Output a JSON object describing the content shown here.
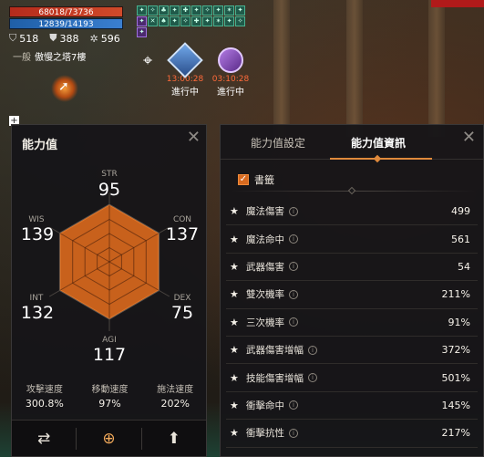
{
  "hud": {
    "hp_text": "68018/73736",
    "mp_text": "12839/14193",
    "stat_a": "518",
    "stat_b": "388",
    "stat_c": "596",
    "location_tag": "一般",
    "location_name": "傲慢之塔7樓",
    "quests": [
      {
        "timer": "13:00:28",
        "state": "進行中"
      },
      {
        "timer": "03:10:28",
        "state": "進行中"
      }
    ]
  },
  "left_panel": {
    "title": "能力值",
    "stats": {
      "str": {
        "label": "STR",
        "value": "95"
      },
      "con": {
        "label": "CON",
        "value": "137"
      },
      "dex": {
        "label": "DEX",
        "value": "75"
      },
      "agi": {
        "label": "AGI",
        "value": "117"
      },
      "int": {
        "label": "INT",
        "value": "132"
      },
      "wis": {
        "label": "WIS",
        "value": "139"
      }
    },
    "speeds": [
      {
        "label": "攻擊速度",
        "value": "300.8%"
      },
      {
        "label": "移動速度",
        "value": "97%"
      },
      {
        "label": "施法速度",
        "value": "202%"
      }
    ]
  },
  "right_panel": {
    "tabs": [
      "能力值設定",
      "能力值資訊"
    ],
    "active_tab": "能力值資訊",
    "bookmark_label": "書籤",
    "rows": [
      {
        "name": "魔法傷害",
        "value": "499"
      },
      {
        "name": "魔法命中",
        "value": "561"
      },
      {
        "name": "武器傷害",
        "value": "54"
      },
      {
        "name": "雙次機率",
        "value": "211%"
      },
      {
        "name": "三次機率",
        "value": "91%"
      },
      {
        "name": "武器傷害增幅",
        "value": "372%"
      },
      {
        "name": "技能傷害增幅",
        "value": "501%"
      },
      {
        "name": "衝擊命中",
        "value": "145%"
      },
      {
        "name": "衝擊抗性",
        "value": "217%"
      }
    ]
  },
  "colors": {
    "accent": "#e08a3c",
    "radar_fill": "#c8611c",
    "hp": "#c03a22",
    "mp": "#2f6fc0"
  }
}
